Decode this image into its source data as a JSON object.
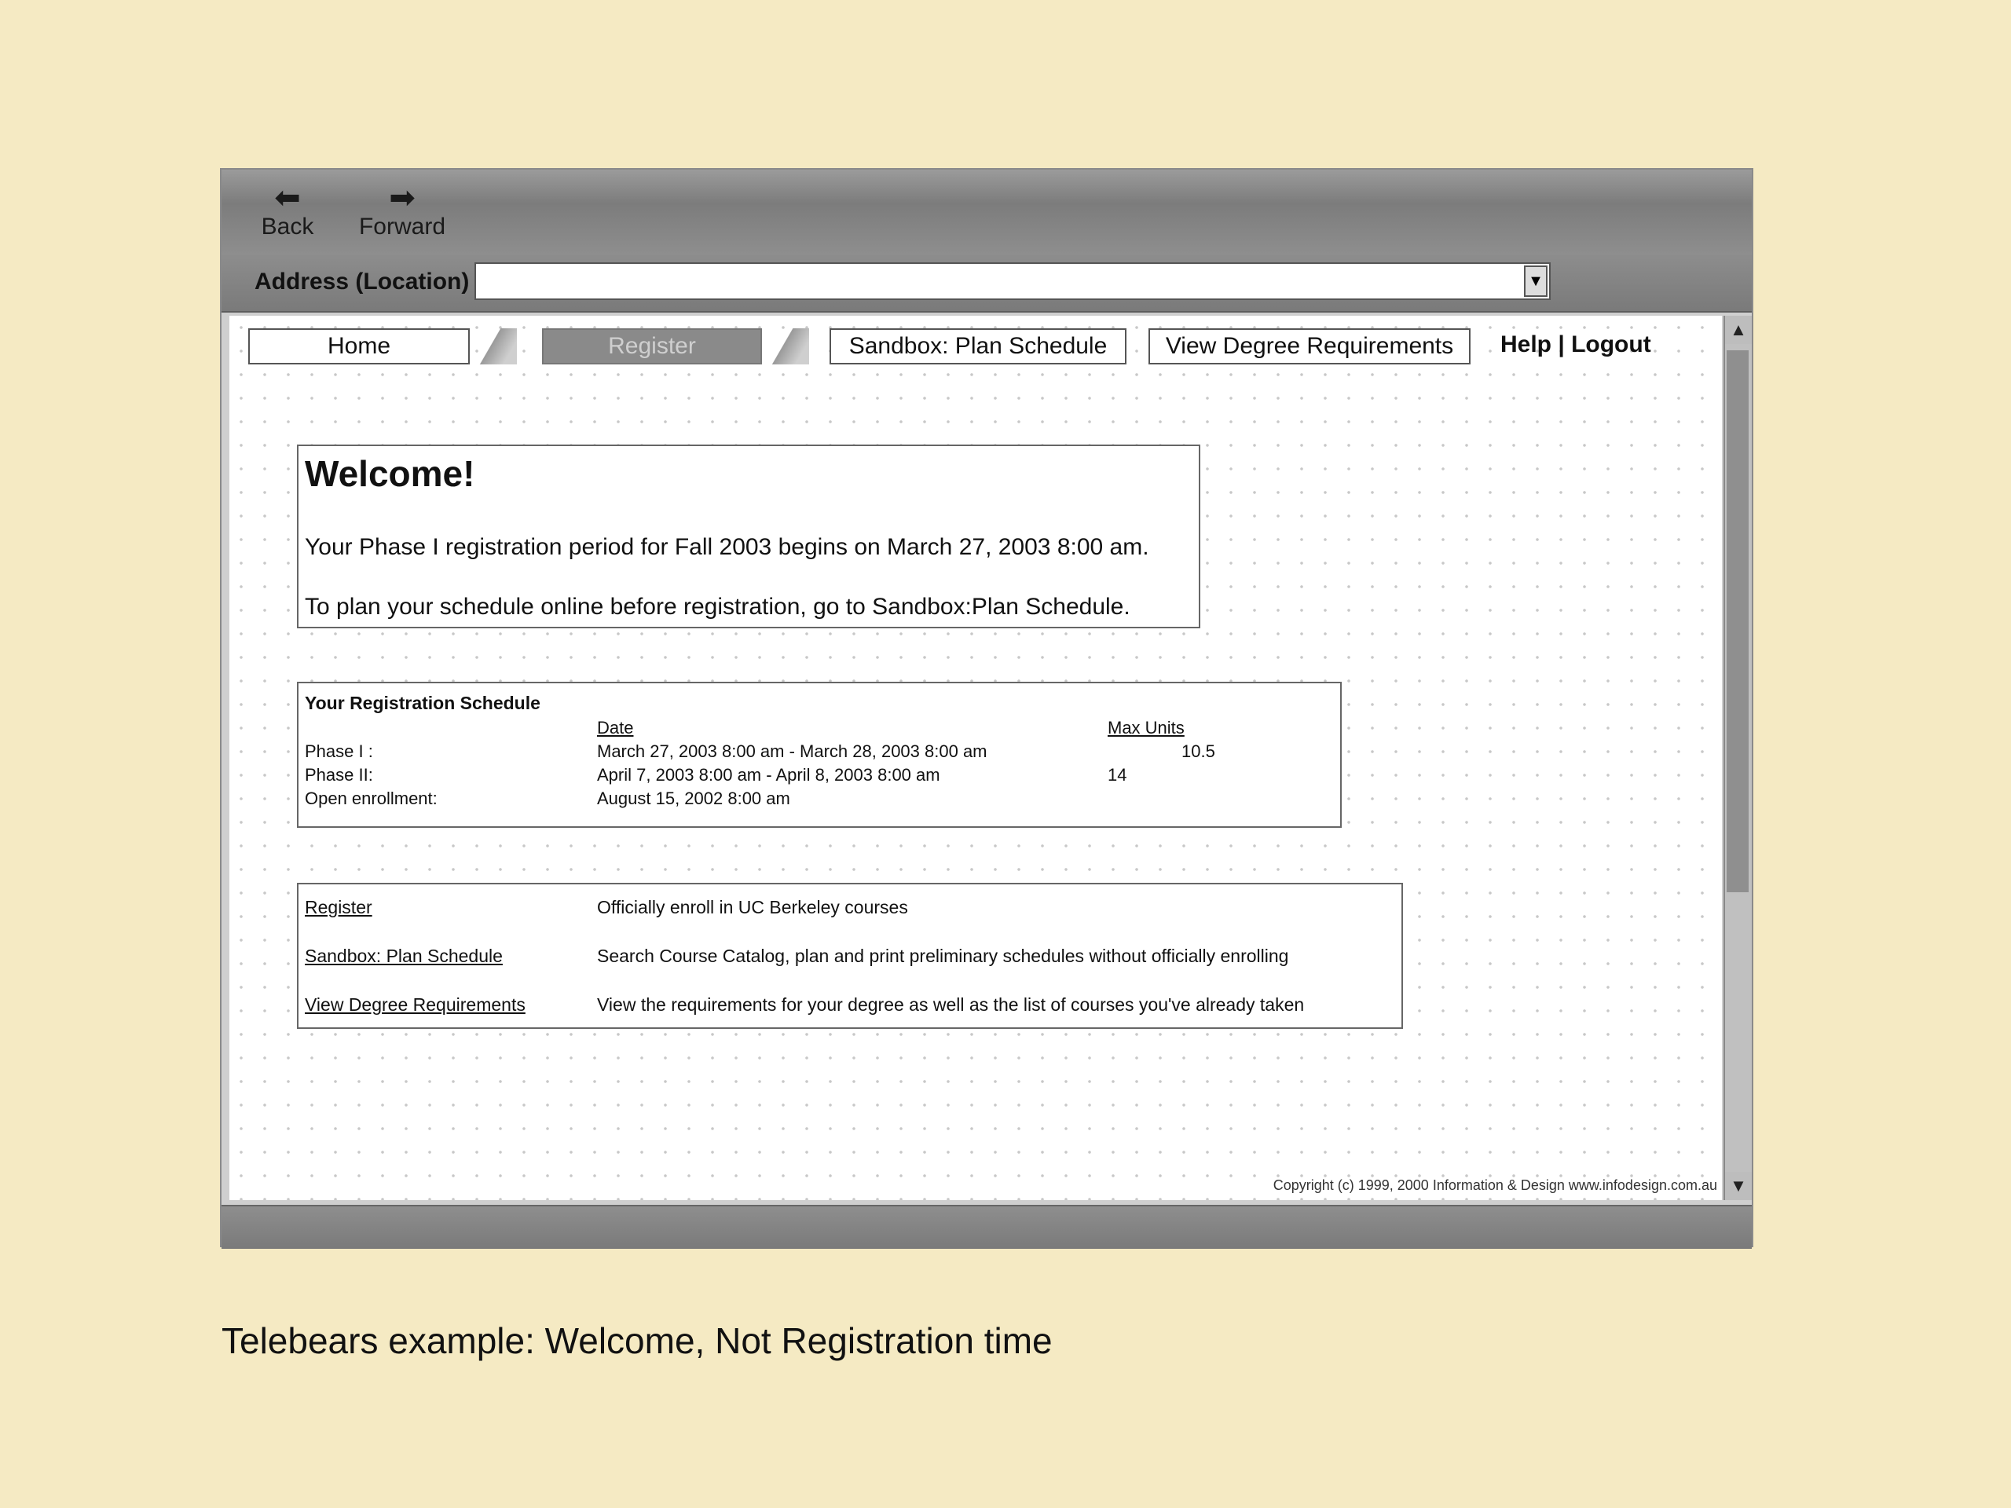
{
  "browser": {
    "back_label": "Back",
    "forward_label": "Forward",
    "back_icon": "left-arrow-icon",
    "forward_icon": "right-arrow-icon",
    "address_label": "Address (Location)",
    "address_value": ""
  },
  "tabs": [
    {
      "label": "Home",
      "state": "normal"
    },
    {
      "label": "Register",
      "state": "active"
    },
    {
      "label": "Sandbox: Plan Schedule",
      "state": "normal"
    },
    {
      "label": "View Degree Requirements",
      "state": "normal"
    }
  ],
  "help_logout": "Help | Logout",
  "welcome": {
    "title": "Welcome!",
    "line1": "Your Phase I registration period for  Fall 2003 begins on March 27, 2003 8:00 am.",
    "line2": "To plan your schedule online before registration, go to Sandbox:Plan Schedule."
  },
  "schedule": {
    "title": "Your Registration Schedule",
    "col_date": "Date",
    "col_max_units": "Max Units",
    "rows": [
      {
        "phase": "Phase I :",
        "date": "March 27, 2003 8:00 am - March 28, 2003 8:00 am",
        "units": "10.5"
      },
      {
        "phase": "Phase II:",
        "date": "April 7, 2003 8:00 am - April 8, 2003 8:00 am",
        "units": "14"
      },
      {
        "phase": "Open enrollment:",
        "date": "August 15, 2002 8:00 am",
        "units": ""
      }
    ]
  },
  "links": [
    {
      "label": "Register",
      "desc": "Officially enroll in UC Berkeley courses"
    },
    {
      "label": "Sandbox: Plan Schedule",
      "desc": "Search Course Catalog, plan and print preliminary schedules without officially enrolling"
    },
    {
      "label": "View Degree Requirements",
      "desc": "View the requirements for your degree as well as the list of courses you've already taken"
    }
  ],
  "copyright": "Copyright (c) 1999, 2000 Information & Design www.infodesign.com.au",
  "caption": "Telebears example: Welcome, Not Registration time"
}
